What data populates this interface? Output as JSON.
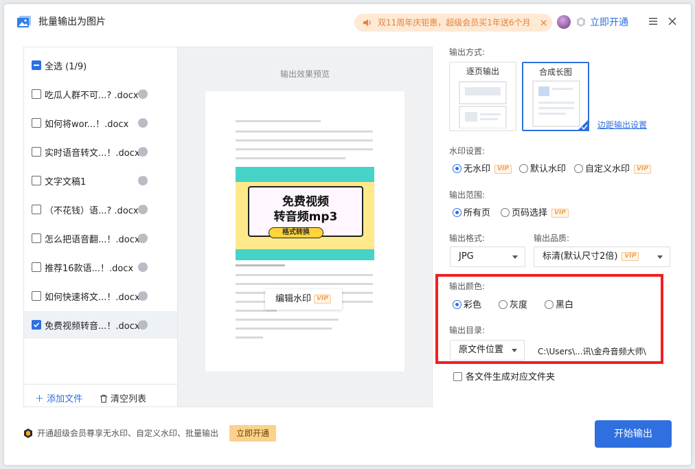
{
  "app": {
    "title": "批量输出为图片"
  },
  "promo": {
    "text": "双11周年庆钜惠，超级会员买1年送6个月"
  },
  "header": {
    "open_label": "立即开通"
  },
  "filelist": {
    "select_all": "全选 (1/9)",
    "items": [
      {
        "name": "吃瓜人群不可...? .docx",
        "checked": false
      },
      {
        "name": "如何将wor...！.docx",
        "checked": false
      },
      {
        "name": "实时语音转文...！.docx",
        "checked": false
      },
      {
        "name": "文字文稿1",
        "checked": false
      },
      {
        "name": "（不花钱）语...? .docx",
        "checked": false
      },
      {
        "name": "怎么把语音翻...！.docx",
        "checked": false
      },
      {
        "name": "推荐16款语...！.docx",
        "checked": false
      },
      {
        "name": "如何快速将文...！.docx",
        "checked": false
      },
      {
        "name": "免费视频转音...！.docx",
        "checked": true
      }
    ],
    "add_label": "添加文件",
    "clear_label": "清空列表"
  },
  "preview": {
    "title": "输出效果预览",
    "banner_line1": "免费视频",
    "banner_line2": "转音频mp3",
    "banner_tag": "格式转换",
    "watermark_button": "编辑水印"
  },
  "vip_tag": "VIP",
  "settings": {
    "output_mode": {
      "label": "输出方式:",
      "options": [
        "逐页输出",
        "合成长图"
      ],
      "selected": "合成长图"
    },
    "margin_link": "边距输出设置",
    "watermark": {
      "label": "水印设置:",
      "options": [
        "无水印",
        "默认水印",
        "自定义水印"
      ],
      "selected": "无水印"
    },
    "range": {
      "label": "输出范围:",
      "options": [
        "所有页",
        "页码选择"
      ],
      "selected": "所有页"
    },
    "format": {
      "label": "输出格式:",
      "value": "JPG"
    },
    "quality": {
      "label": "输出品质:",
      "value": "标清(默认尺寸2倍)"
    },
    "color": {
      "label": "输出颜色:",
      "options": [
        "彩色",
        "灰度",
        "黑白"
      ],
      "selected": "彩色"
    },
    "directory": {
      "label": "输出目录:",
      "value": "原文件位置",
      "path": "C:\\Users\\...讯\\金舟音频大师\\"
    },
    "per_file_folder": "各文件生成对应文件夹"
  },
  "bottom": {
    "note": "开通超级会员尊享无水印、自定义水印、批量输出",
    "open_label": "立即开通",
    "start_label": "开始输出"
  },
  "colors": {
    "accent": "#2f6fe0",
    "highlight_border": "#f0201f",
    "promo_bg": "#fde9d4",
    "promo_text": "#e8823a"
  }
}
